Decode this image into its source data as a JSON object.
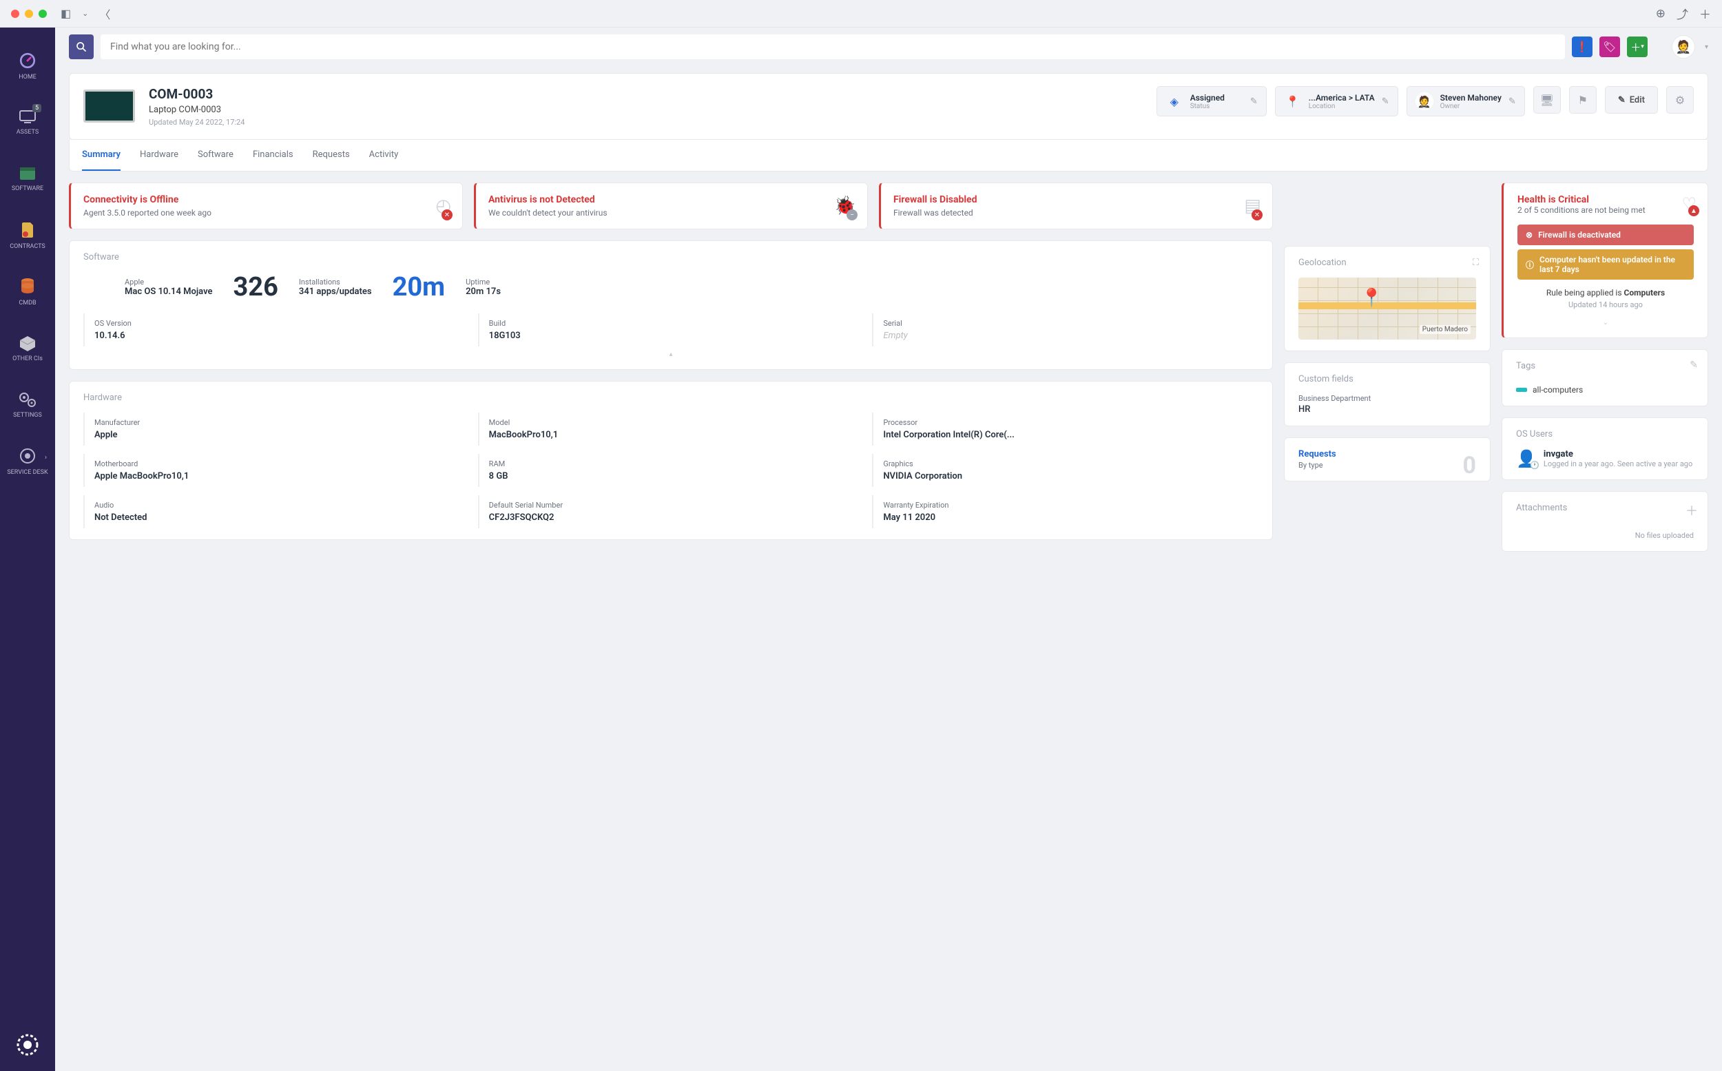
{
  "search": {
    "placeholder": "Find what you are looking for..."
  },
  "sidebar": {
    "items": [
      {
        "label": "HOME"
      },
      {
        "label": "ASSETS",
        "badge": "5"
      },
      {
        "label": "SOFTWARE"
      },
      {
        "label": "CONTRACTS"
      },
      {
        "label": "CMDB"
      },
      {
        "label": "OTHER CIs"
      },
      {
        "label": "SETTINGS"
      },
      {
        "label": "SERVICE DESK"
      }
    ]
  },
  "asset": {
    "code": "COM-0003",
    "name": "Laptop COM-0003",
    "updated": "Updated May 24 2022, 17:24"
  },
  "headerCards": {
    "status": {
      "title": "Assigned",
      "sub": "Status"
    },
    "location": {
      "title": "...America > LATA",
      "sub": "Location"
    },
    "owner": {
      "title": "Steven Mahoney",
      "sub": "Owner"
    },
    "edit": "Edit"
  },
  "tabs": [
    "Summary",
    "Hardware",
    "Software",
    "Financials",
    "Requests",
    "Activity"
  ],
  "status": {
    "connectivity": {
      "title": "Connectivity is Offline",
      "sub": "Agent 3.5.0 reported one week ago"
    },
    "antivirus": {
      "title": "Antivirus is not Detected",
      "sub": "We couldn't detect your antivirus"
    },
    "firewall": {
      "title": "Firewall is Disabled",
      "sub": "Firewall was detected"
    }
  },
  "software": {
    "title": "Software",
    "os_vendor": "Apple",
    "os_name": "Mac OS 10.14 Mojave",
    "installations_big": "326",
    "installations_label": "Installations",
    "installations_sub": "341 apps/updates",
    "uptime_big": "20m",
    "uptime_label": "Uptime",
    "uptime_sub": "20m 17s",
    "fields": {
      "os_version": {
        "label": "OS Version",
        "value": "10.14.6"
      },
      "build": {
        "label": "Build",
        "value": "18G103"
      },
      "serial": {
        "label": "Serial",
        "value": "Empty"
      }
    }
  },
  "hardware": {
    "title": "Hardware",
    "fields": {
      "manufacturer": {
        "label": "Manufacturer",
        "value": "Apple"
      },
      "model": {
        "label": "Model",
        "value": "MacBookPro10,1"
      },
      "processor": {
        "label": "Processor",
        "value": "Intel Corporation Intel(R) Core(..."
      },
      "motherboard": {
        "label": "Motherboard",
        "value": "Apple MacBookPro10,1"
      },
      "ram": {
        "label": "RAM",
        "value": "8 GB"
      },
      "graphics": {
        "label": "Graphics",
        "value": "NVIDIA Corporation"
      },
      "audio": {
        "label": "Audio",
        "value": "Not Detected"
      },
      "default_serial": {
        "label": "Default Serial Number",
        "value": "CF2J3FSQCKQ2"
      },
      "warranty": {
        "label": "Warranty Expiration",
        "value": "May 11 2020"
      }
    }
  },
  "geolocation": {
    "title": "Geolocation",
    "place": "Puerto Madero"
  },
  "customFields": {
    "title": "Custom fields",
    "label": "Business Department",
    "value": "HR"
  },
  "requests": {
    "title": "Requests",
    "sub": "By type",
    "count": "0"
  },
  "health": {
    "title": "Health is Critical",
    "sub": "2 of 5 conditions are not being met",
    "alerts": [
      "Firewall is deactivated",
      "Computer hasn't been updated in the last 7 days"
    ],
    "rule_prefix": "Rule being applied is ",
    "rule_name": "Computers",
    "rule_updated": "Updated 14 hours ago"
  },
  "tags": {
    "title": "Tags",
    "tag": "all-computers"
  },
  "osusers": {
    "title": "OS Users",
    "name": "invgate",
    "desc": "Logged in a year ago. Seen active a year ago"
  },
  "attachments": {
    "title": "Attachments",
    "empty": "No files uploaded"
  }
}
